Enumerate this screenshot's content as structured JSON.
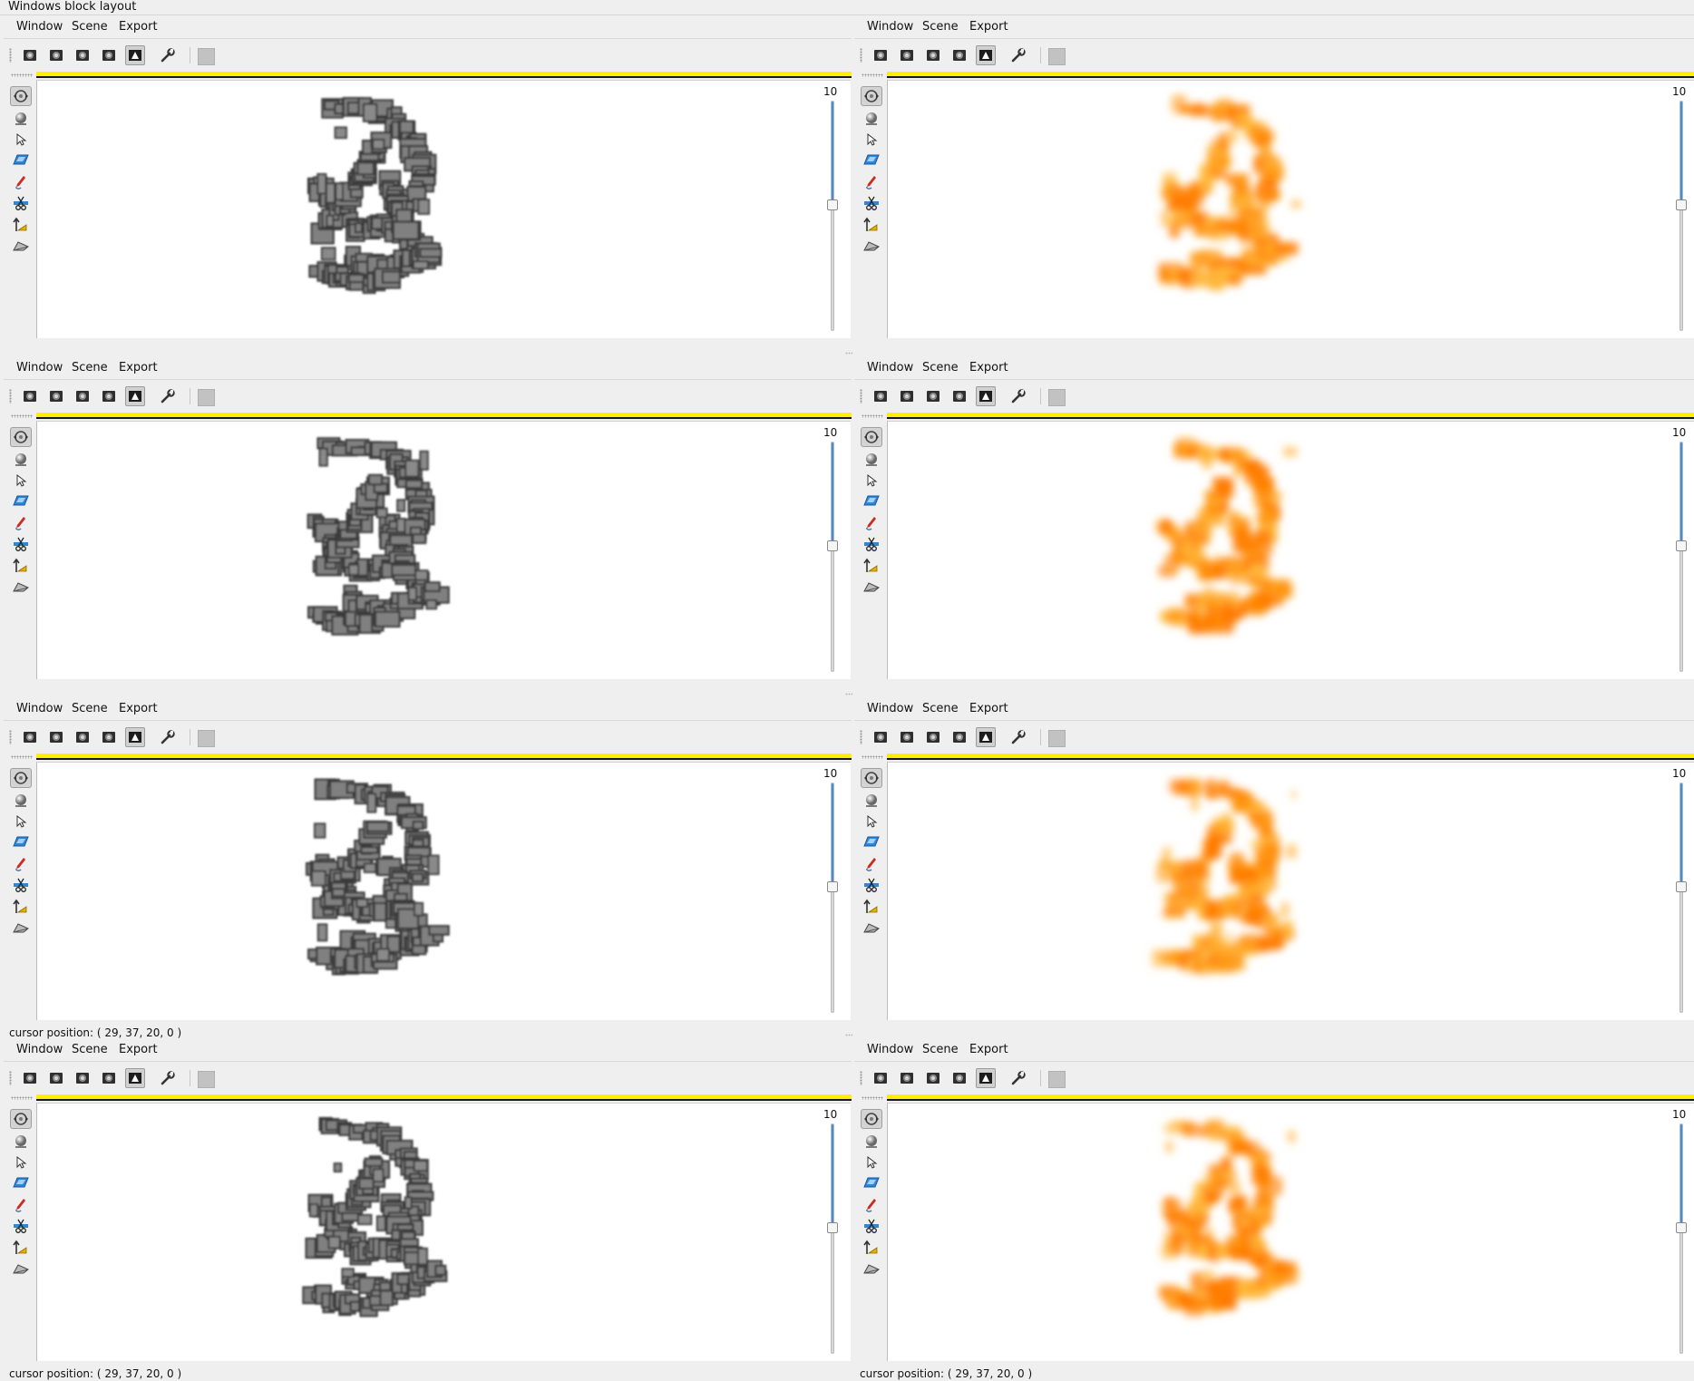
{
  "window_title": "Windows block layout",
  "menus": {
    "window": "Window",
    "scene": "Scene",
    "export": "Export"
  },
  "toolbar_icons": [
    "camera-icon",
    "camera-icon",
    "camera-icon",
    "camera-icon",
    "volume-render-icon",
    "wrench-icon"
  ],
  "side_icons": [
    "rotate-icon",
    "sphere-icon",
    "pointer-icon",
    "slice-icon",
    "pen-icon",
    "cut-icon",
    "transform-icon",
    "plane-icon"
  ],
  "slider": {
    "label": "10",
    "value_fraction": 0.55
  },
  "cursor_position": "cursor position: ( 29, 37, 20, 0 )",
  "panes": [
    {
      "id": "r1-left",
      "style": "gray"
    },
    {
      "id": "r1-right",
      "style": "orange"
    },
    {
      "id": "r2-left",
      "style": "gray"
    },
    {
      "id": "r2-right",
      "style": "orange"
    },
    {
      "id": "r3-left",
      "style": "gray"
    },
    {
      "id": "r3-right",
      "style": "orange"
    },
    {
      "id": "r4-left",
      "style": "gray"
    },
    {
      "id": "r4-right",
      "style": "orange"
    }
  ],
  "colors": {
    "accent": "#3c8ee0",
    "highlight_bar": "#ffee00",
    "voxel_gray": "#7a7a7a",
    "volume_orange": "#ff8a00"
  }
}
